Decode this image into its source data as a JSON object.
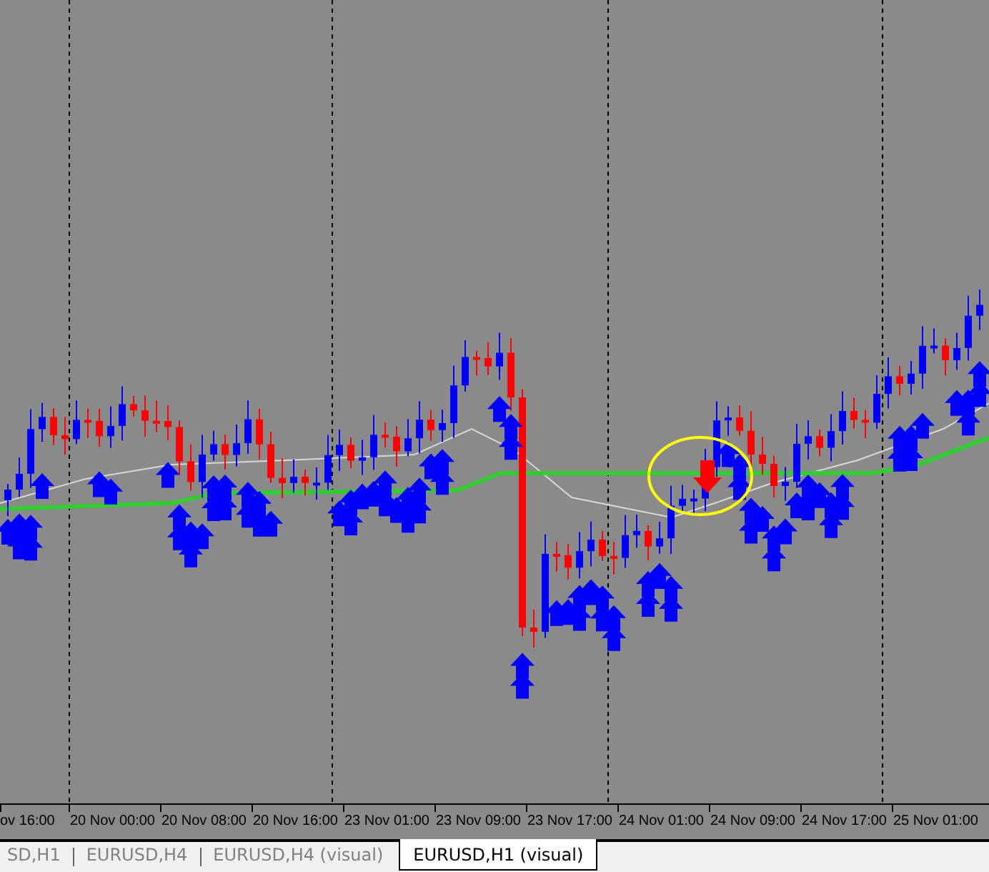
{
  "time_axis": {
    "labels": [
      "ov 16:00",
      "20 Nov 00:00",
      "20 Nov 08:00",
      "20 Nov 16:00",
      "23 Nov 01:00",
      "23 Nov 09:00",
      "23 Nov 17:00",
      "24 Nov 01:00",
      "24 Nov 09:00",
      "24 Nov 17:00",
      "25 Nov 01:00"
    ]
  },
  "tabs": [
    {
      "label": "SD,H1",
      "selected": false
    },
    {
      "label": "EURUSD,H4",
      "selected": false
    },
    {
      "label": "EURUSD,H4 (visual)",
      "selected": false
    },
    {
      "label": "EURUSD,H1 (visual)",
      "selected": true
    }
  ]
}
